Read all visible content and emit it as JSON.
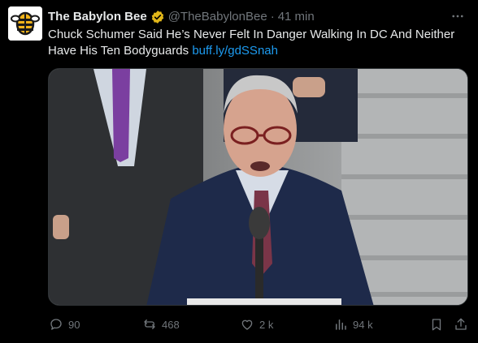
{
  "tweet": {
    "author_name": "The Babylon Bee",
    "handle": "@TheBabylonBee",
    "separator": "·",
    "time": "41 min",
    "text": "Chuck Schumer Said He’s Never Felt In Danger Walking In DC And Neither Have His Ten Bodyguards",
    "link": "buff.ly/gdSSnah"
  },
  "actions": {
    "replies": "90",
    "reposts": "468",
    "likes": "2 k",
    "views": "94 k"
  },
  "colors": {
    "background": "#000000",
    "text": "#e7e9ea",
    "muted": "#71767b",
    "link": "#1d9bf0",
    "verified": "#e2b719"
  },
  "icons": [
    "babylon-bee-logo",
    "verified-badge-icon",
    "more-icon",
    "reply-icon",
    "repost-icon",
    "like-icon",
    "views-icon",
    "bookmark-icon",
    "share-icon"
  ]
}
